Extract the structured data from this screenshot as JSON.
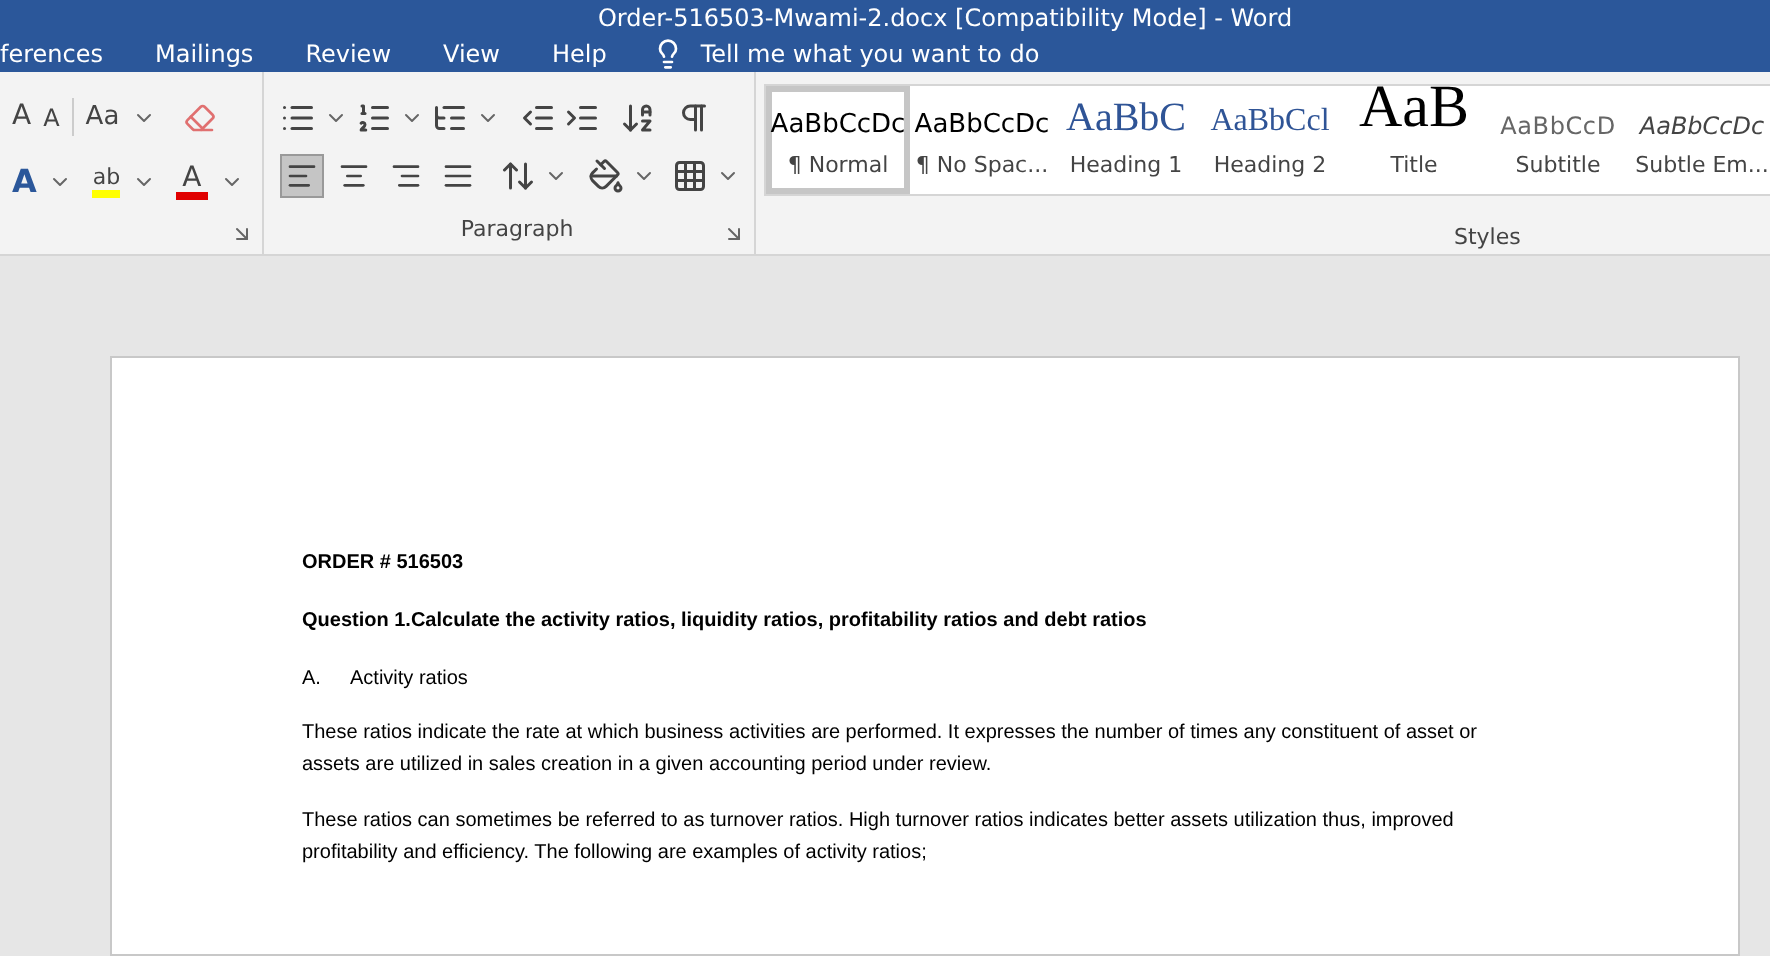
{
  "window": {
    "title": "Order-516503-Mwami-2.docx [Compatibility Mode]  -  Word"
  },
  "tabs": [
    {
      "label": "ferences",
      "selected": false
    },
    {
      "label": "Mailings",
      "selected": false
    },
    {
      "label": "Review",
      "selected": false
    },
    {
      "label": "View",
      "selected": false
    },
    {
      "label": "Help",
      "selected": false
    }
  ],
  "tell_me": {
    "placeholder": "Tell me what you want to do"
  },
  "font_group": {
    "grow": "A",
    "shrink": "A",
    "change_case": "Aa",
    "text_effects": "A",
    "highlight": "ab",
    "font_color": "A"
  },
  "paragraph_group": {
    "label": "Paragraph",
    "alignments": [
      {
        "kind": "left",
        "selected": true
      },
      {
        "kind": "center",
        "selected": false
      },
      {
        "kind": "right",
        "selected": false
      },
      {
        "kind": "justify",
        "selected": false
      }
    ]
  },
  "styles_group": {
    "label": "Styles",
    "styles": [
      {
        "kind": "normal",
        "preview": "AaBbCcDc",
        "name": "¶ Normal",
        "selected": true
      },
      {
        "kind": "normal",
        "preview": "AaBbCcDc",
        "name": "¶ No Spac...",
        "selected": false
      },
      {
        "kind": "heading1",
        "preview": "AaBbC",
        "name": "Heading 1",
        "selected": false
      },
      {
        "kind": "heading2",
        "preview": "AaBbCcl",
        "name": "Heading 2",
        "selected": false
      },
      {
        "kind": "title",
        "preview": "AaB",
        "name": "Title",
        "selected": false
      },
      {
        "kind": "subtitle",
        "preview": "AaBbCcD",
        "name": "Subtitle",
        "selected": false
      },
      {
        "kind": "emphasis",
        "preview": "AaBbCcDc",
        "name": "Subtle Em...",
        "selected": false
      }
    ]
  },
  "document": {
    "paragraphs": [
      {
        "kind": "bold",
        "text": "ORDER # 516503"
      },
      {
        "kind": "bold",
        "text": "Question 1.Calculate the activity ratios, liquidity ratios, profitability ratios and debt ratios"
      },
      {
        "kind": "list",
        "marker": "A.",
        "text": "Activity ratios"
      },
      {
        "kind": "body",
        "text": "These ratios indicate the rate at which business activities are performed. It expresses the number of times any constituent of asset or assets are utilized in sales creation in a given accounting period under review."
      },
      {
        "kind": "body",
        "text": "These ratios can sometimes be referred to as turnover ratios. High turnover ratios indicates better assets utilization thus, improved profitability and efficiency. The following are examples of activity ratios;"
      }
    ]
  }
}
